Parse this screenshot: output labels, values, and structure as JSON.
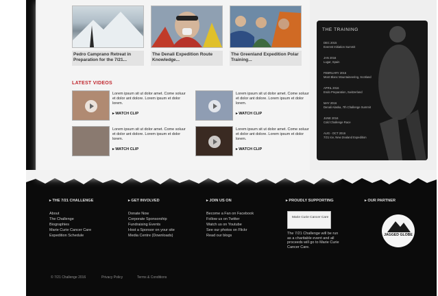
{
  "articles": [
    {
      "caption": "Pedro Camprano Retreat in Preparation for the 7/21..."
    },
    {
      "caption": "The Denali Expedition Route Knowledge..."
    },
    {
      "caption": "The Greenland Expedition Polar Training..."
    }
  ],
  "latest_videos": {
    "title": "LATEST VIDEOS",
    "items": [
      {
        "text": "Lorem ipsum sit ut dolor amet. Come soluur et dolor ant dolore. Lorem ipsum et dolor lorem.",
        "watch": "WATCH CLIP"
      },
      {
        "text": "Lorem ipsum sit ut dolor amet. Come soluur et dolor ant dolore. Lorem ipsum et dolor lorem.",
        "watch": "WATCH CLIP"
      },
      {
        "text": "Lorem ipsum sit ut dolor amet. Come soluur et dolor ant dolore. Lorem ipsum et dolor lorem.",
        "watch": "WATCH CLIP"
      },
      {
        "text": "Lorem ipsum sit ut dolor amet. Come soluur et dolor ant dolore. Lorem ipsum et dolor lorem.",
        "watch": "WATCH CLIP"
      }
    ]
  },
  "training": {
    "title": "THE TRAINING",
    "events": [
      {
        "date": "DEC 2015",
        "detail": "Everest Initiation Summit"
      },
      {
        "date": "JAN 2016",
        "detail": "Lugar, Spain"
      },
      {
        "date": "FEBRUARY 2016",
        "detail": "Mont Blanc Mountaineering, Scotland"
      },
      {
        "date": "APRIL 2016",
        "detail": "Endo Preparation, Switzerland"
      },
      {
        "date": "MAY 2016",
        "detail": "Denali Alaska, 7th Challenge Summit"
      },
      {
        "date": "JUNE 2016",
        "detail": "Cold Challenge Race"
      },
      {
        "date": "AUG - OCT 2016",
        "detail": "7/21 Ice, New Zealand Expedition"
      }
    ]
  },
  "footer": {
    "columns": [
      {
        "heading": "THE 7/21 CHALLENGE",
        "links": [
          "About",
          "The Challenge",
          "Biographies",
          "Marie Curie Cancer Care",
          "Expedition Schedule"
        ]
      },
      {
        "heading": "GET INVOLVED",
        "links": [
          "Donate Now",
          "Corporate Sponsorship",
          "Fundraising Events",
          "Host a Sponsor on your site",
          "Media Centre (Downloads)"
        ]
      },
      {
        "heading": "JOIN US ON",
        "links": [
          "Become a Fan on Facebook",
          "Follow us on Twitter",
          "Watch us on Youtube",
          "See our photos on Flickr",
          "Read our blogs"
        ]
      },
      {
        "heading": "PROUDLY SUPPORTING",
        "links": []
      },
      {
        "heading": "OUR PARTNER",
        "links": []
      }
    ],
    "charity_logo_text": "Marie Curie Cancer Care",
    "supporting_text": "The 7/21 Challenge will be run as a charitable event and all proceeds will go to Marie Curie Cancer Care.",
    "partner_logo_text": "JAGGED GLOBE",
    "legal": [
      "© 7/21 Challenge 2016",
      "Privacy Policy",
      "Terms & Conditions"
    ]
  }
}
